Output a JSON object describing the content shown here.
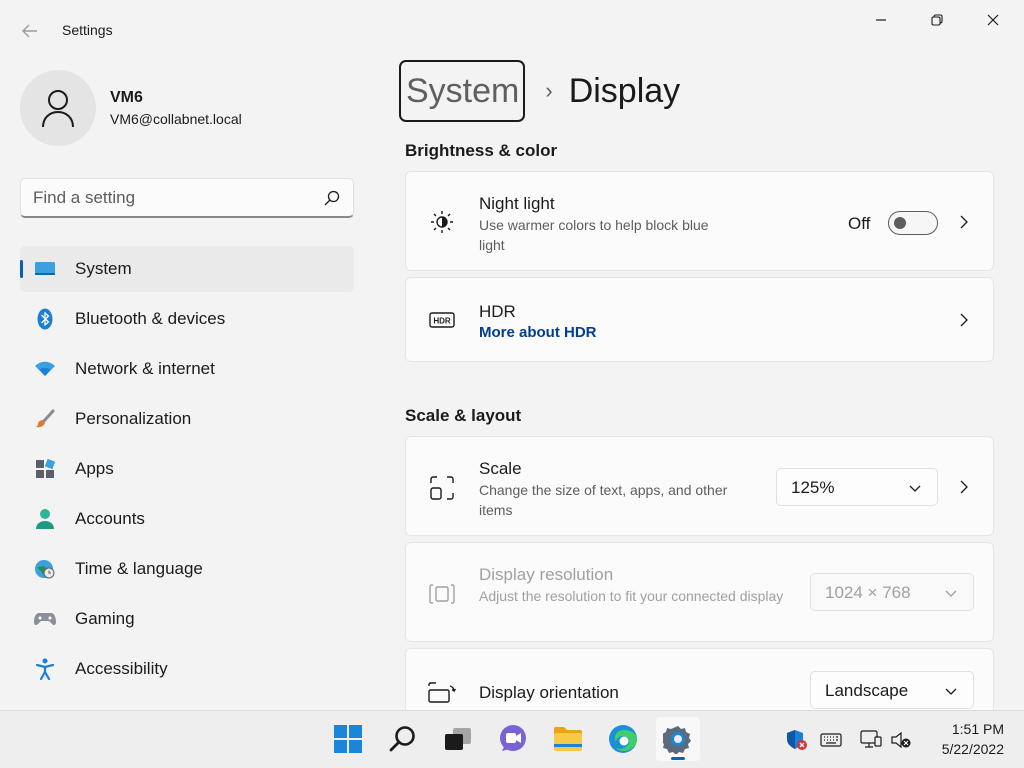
{
  "window": {
    "title": "Settings",
    "controls": {
      "minimize": "minimize-icon",
      "restore": "restore-icon",
      "close": "close-icon"
    }
  },
  "profile": {
    "name": "VM6",
    "email": "VM6@collabnet.local"
  },
  "search": {
    "placeholder": "Find a setting"
  },
  "sidebar": {
    "items": [
      {
        "label": "System",
        "icon": "system-icon",
        "selected": true
      },
      {
        "label": "Bluetooth & devices",
        "icon": "bluetooth-icon"
      },
      {
        "label": "Network & internet",
        "icon": "network-icon"
      },
      {
        "label": "Personalization",
        "icon": "brush-icon"
      },
      {
        "label": "Apps",
        "icon": "apps-icon"
      },
      {
        "label": "Accounts",
        "icon": "accounts-icon"
      },
      {
        "label": "Time & language",
        "icon": "globe-icon"
      },
      {
        "label": "Gaming",
        "icon": "gamepad-icon"
      },
      {
        "label": "Accessibility",
        "icon": "accessibility-icon"
      }
    ]
  },
  "breadcrumb": {
    "parent": "System",
    "separator": "›",
    "current": "Display"
  },
  "sections": {
    "brightness_title": "Brightness & color",
    "scale_title": "Scale & layout"
  },
  "cards": {
    "night_light": {
      "title": "Night light",
      "desc": "Use warmer colors to help block blue light",
      "state": "Off",
      "toggle_on": false
    },
    "hdr": {
      "title": "HDR",
      "link": "More about HDR"
    },
    "scale": {
      "title": "Scale",
      "desc": "Change the size of text, apps, and other items",
      "value": "125%"
    },
    "resolution": {
      "title": "Display resolution",
      "desc": "Adjust the resolution to fit your connected display",
      "value": "1024 × 768",
      "disabled": true
    },
    "orientation": {
      "title": "Display orientation",
      "value": "Landscape"
    }
  },
  "taskbar": {
    "apps": [
      "start-icon",
      "search-icon",
      "task-view-icon",
      "chat-icon",
      "file-explorer-icon",
      "edge-icon",
      "settings-icon"
    ],
    "active_app": "settings-icon",
    "tray": [
      "defender-icon",
      "keyboard-icon",
      "network-status-icon",
      "volume-muted-icon"
    ],
    "time": "1:51 PM",
    "date": "5/22/2022"
  },
  "colors": {
    "accent": "#005fb8",
    "link": "#003e92",
    "background": "#f3f3f3",
    "card": "#fbfbfb"
  }
}
